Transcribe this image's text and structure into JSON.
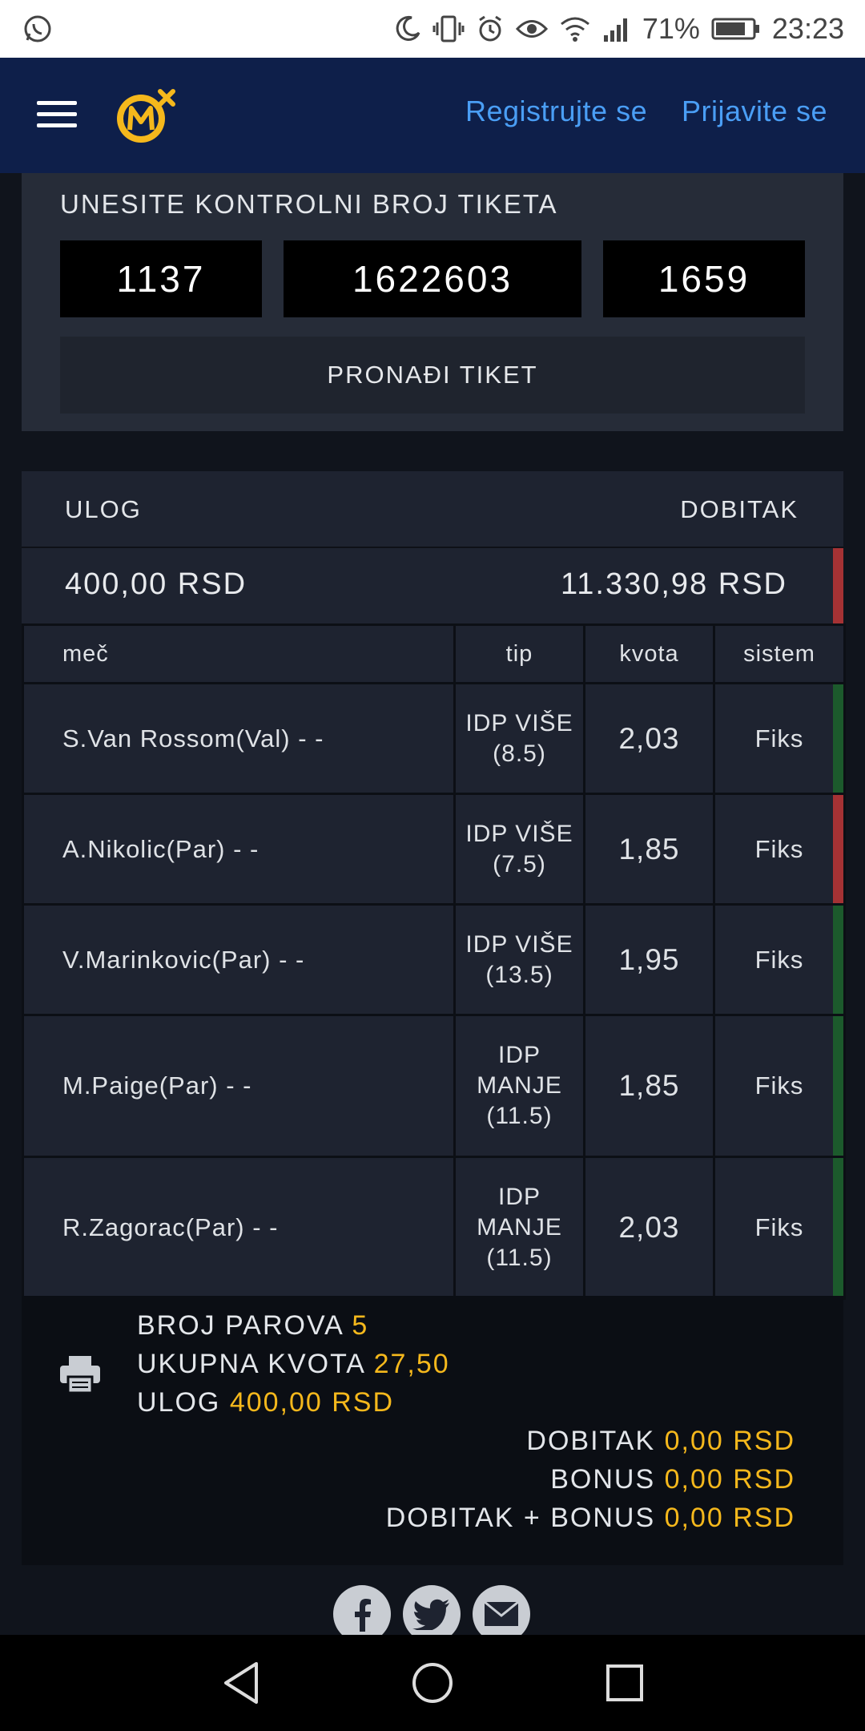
{
  "status_bar": {
    "battery_percent": "71%",
    "time": "23:23",
    "icons": [
      "whatsapp-icon",
      "moon-icon",
      "vibrate-icon",
      "alarm-icon",
      "eye-icon",
      "wifi-icon",
      "signal-icon",
      "battery-icon"
    ]
  },
  "header": {
    "register_label": "Registrujte se",
    "login_label": "Prijavite se",
    "colors": {
      "background": "#0e1f4a",
      "link": "#4a9ef5",
      "logo": "#f5b81c"
    }
  },
  "control": {
    "title": "UNESITE KONTROLNI BROJ TIKETA",
    "fields": [
      "1137",
      "1622603",
      "1659"
    ],
    "find_label": "PRONAĐI TIKET"
  },
  "ticket": {
    "stake_label": "ULOG",
    "win_label": "DOBITAK",
    "stake_value": "400,00 RSD",
    "win_value": "11.330,98 RSD",
    "columns": {
      "match": "meč",
      "tip": "tip",
      "odd": "kvota",
      "system": "sistem"
    },
    "rows": [
      {
        "match": "S.Van Rossom(Val) - -",
        "tip": "IDP VIŠE (8.5)",
        "odd": "2,03",
        "system": "Fiks",
        "status": "win"
      },
      {
        "match": "A.Nikolic(Par) - -",
        "tip": "IDP VIŠE (7.5)",
        "odd": "1,85",
        "system": "Fiks",
        "status": "lose"
      },
      {
        "match": "V.Marinkovic(Par) - -",
        "tip": "IDP VIŠE (13.5)",
        "odd": "1,95",
        "system": "Fiks",
        "status": "win"
      },
      {
        "match": "M.Paige(Par) - -",
        "tip": "IDP MANJE (11.5)",
        "odd": "1,85",
        "system": "Fiks",
        "status": "win"
      },
      {
        "match": "R.Zagorac(Par) - -",
        "tip": "IDP MANJE (11.5)",
        "odd": "2,03",
        "system": "Fiks",
        "status": "win"
      }
    ],
    "status_colors": {
      "win": "#1c5a2c",
      "lose": "#a53234"
    }
  },
  "summary": {
    "pairs_label": "BROJ PAROVA",
    "pairs_value": "5",
    "total_odd_label": "UKUPNA KVOTA",
    "total_odd_value": "27,50",
    "stake_label": "ULOG",
    "stake_value": "400,00 RSD",
    "win_label": "DOBITAK",
    "win_value": "0,00 RSD",
    "bonus_label": "BONUS",
    "bonus_value": "0,00 RSD",
    "win_bonus_label": "DOBITAK + BONUS",
    "win_bonus_value": "0,00 RSD",
    "highlight_color": "#f5b81c"
  },
  "share": [
    "facebook-icon",
    "twitter-icon",
    "email-icon"
  ],
  "nav_bar": [
    "back-icon",
    "home-icon",
    "recents-icon"
  ]
}
